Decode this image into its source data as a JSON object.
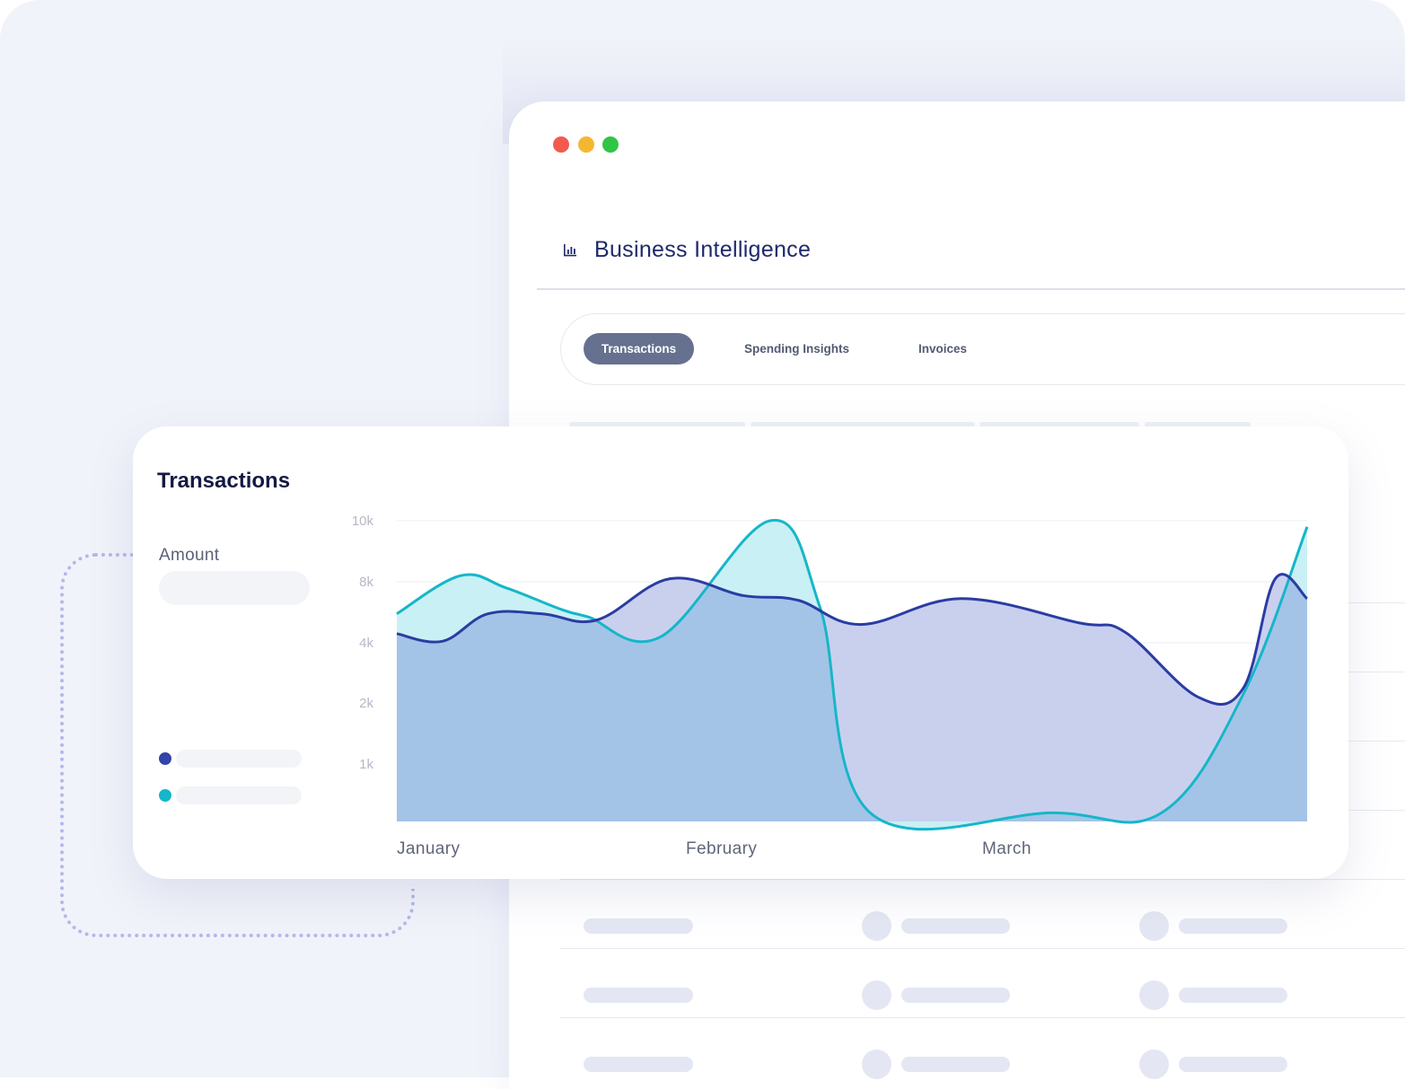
{
  "window": {
    "controls": [
      "close",
      "minimize",
      "maximize"
    ],
    "title": "Business Intelligence",
    "title_icon": "bar-chart-icon"
  },
  "tabs": [
    {
      "label": "Transactions",
      "active": true
    },
    {
      "label": "Spending Insights",
      "active": false
    },
    {
      "label": "Invoices",
      "active": false
    }
  ],
  "card": {
    "title": "Transactions",
    "amount_label": "Amount",
    "legend": [
      {
        "color": "#3344aa"
      },
      {
        "color": "#16b6c9"
      }
    ]
  },
  "chart_data": {
    "type": "area",
    "title": "Transactions",
    "y_tick_labels": [
      "10k",
      "8k",
      "4k",
      "2k",
      "1k"
    ],
    "x_tick_labels": [
      "January",
      "February",
      "March"
    ],
    "y_scale": "non-linear (tick labels evenly spaced)",
    "grid": true,
    "series": [
      {
        "color": "#16b6c9",
        "fill": "#c9f0f4",
        "points": [
          [
            0.0,
            5.9
          ],
          [
            0.07,
            8.2
          ],
          [
            0.12,
            7.6
          ],
          [
            0.18,
            6.2
          ],
          [
            0.21,
            5.7
          ],
          [
            0.29,
            4.4
          ],
          [
            0.41,
            10.0
          ],
          [
            0.465,
            6.3
          ],
          [
            0.52,
            0.15
          ],
          [
            0.72,
            0.15
          ],
          [
            0.84,
            0.15
          ],
          [
            0.93,
            2.3
          ],
          [
            1.0,
            9.8
          ]
        ]
      },
      {
        "color": "#2b3ca3",
        "fill": "#c9d0ee",
        "points": [
          [
            0.0,
            4.6
          ],
          [
            0.05,
            4.1
          ],
          [
            0.1,
            5.9
          ],
          [
            0.16,
            5.9
          ],
          [
            0.22,
            5.5
          ],
          [
            0.3,
            8.1
          ],
          [
            0.38,
            7.1
          ],
          [
            0.44,
            6.8
          ],
          [
            0.51,
            5.2
          ],
          [
            0.62,
            6.9
          ],
          [
            0.75,
            5.3
          ],
          [
            0.8,
            4.7
          ],
          [
            0.88,
            2.2
          ],
          [
            0.93,
            2.5
          ],
          [
            0.965,
            8.1
          ],
          [
            1.0,
            6.9
          ]
        ]
      }
    ],
    "overlap_fill": "#a3c4e6"
  }
}
